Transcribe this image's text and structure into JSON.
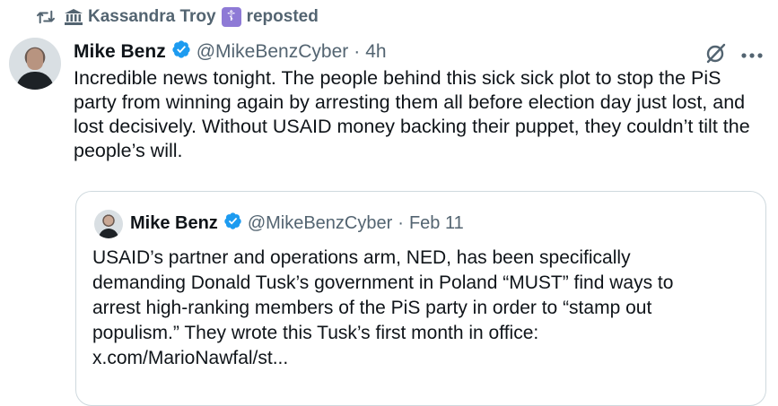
{
  "repost": {
    "reposter": "Kassandra Troy",
    "label": "reposted"
  },
  "tweet": {
    "author_name": "Mike Benz",
    "handle": "@MikeBenzCyber",
    "separator": "·",
    "time": "4h",
    "text": "Incredible news tonight. The people behind this sick sick plot to stop the PiS party from winning again by arresting them all before election day just lost, and lost decisively. Without USAID money backing their puppet, they couldn’t tilt the people’s will."
  },
  "quote": {
    "author_name": "Mike Benz",
    "handle": "@MikeBenzCyber",
    "separator": "·",
    "time": "Feb 11",
    "text_lines": [
      "USAID’s partner and operations arm, NED, has been specifically",
      "demanding Donald Tusk’s government in Poland “MUST” find ways to",
      "arrest high-ranking members of the PiS party in order to “stamp out",
      "populism.” They wrote this Tusk’s first month in office:",
      "x.com/MarioNawfal/st..."
    ]
  },
  "colors": {
    "verified": "#1d9bf0",
    "secondary_text": "#536471",
    "primary_text": "#0f1419",
    "border": "#cfd9de"
  },
  "icons": {
    "repost": "repost-icon",
    "building": "building-icon",
    "cross": "orthodox-cross-icon",
    "verified": "verified-badge-icon",
    "grok": "grok-icon",
    "more": "more-icon"
  }
}
